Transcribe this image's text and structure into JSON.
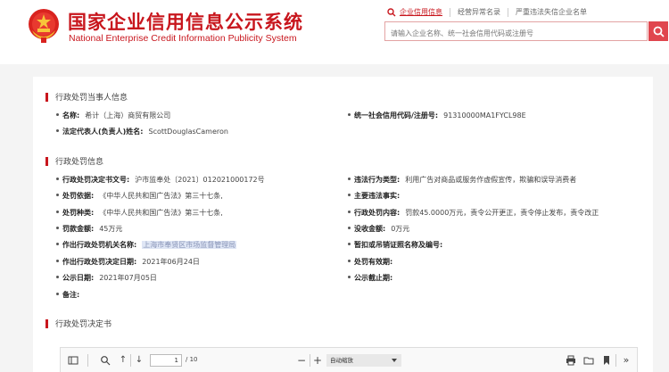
{
  "header": {
    "title_cn": "国家企业信用信息公示系统",
    "title_en": "National Enterprise Credit Information Publicity System",
    "nav": [
      {
        "label": "企业信用信息"
      },
      {
        "label": "经营异常名录"
      },
      {
        "label": "严重违法失信企业名单"
      }
    ],
    "search_placeholder": "请输入企业名称、统一社会信用代码或注册号"
  },
  "party_section": {
    "title": "行政处罚当事人信息",
    "name_label": "名称:",
    "name_value": "希计（上海）商贸有限公司",
    "credit_code_label": "统一社会信用代码/注册号:",
    "credit_code_value": "91310000MA1FYCL98E",
    "legal_rep_label": "法定代表人(负责人)姓名:",
    "legal_rep_value": "ScottDouglasCameron"
  },
  "penalty_section": {
    "title": "行政处罚信息",
    "left": [
      {
        "label": "行政处罚决定书文号:",
        "value": "沪市监奉处〔2021〕012021000172号"
      },
      {
        "label": "处罚依据:",
        "value": "《中华人民共和国广告法》第三十七条,"
      },
      {
        "label": "处罚种类:",
        "value": "《中华人民共和国广告法》第三十七条,"
      },
      {
        "label": "罚款金额:",
        "value": "45万元"
      },
      {
        "label": "作出行政处罚机关名称:",
        "value": "上海市奉贤区市场监督管理局"
      },
      {
        "label": "作出行政处罚决定日期:",
        "value": "2021年06月24日"
      },
      {
        "label": "公示日期:",
        "value": "2021年07月05日"
      },
      {
        "label": "备注:",
        "value": ""
      }
    ],
    "right": [
      {
        "label": "违法行为类型:",
        "value": "利用广告对商品或服务作虚假宣传，欺骗和误导消费者"
      },
      {
        "label": "主要违法事实:",
        "value": ""
      },
      {
        "label": "行政处罚内容:",
        "value": "罚款45.0000万元，责令公开更正，责令停止发布，责令改正"
      },
      {
        "label": "没收金额:",
        "value": "0万元"
      },
      {
        "label": "暂扣或吊销证照名称及编号:",
        "value": ""
      },
      {
        "label": "处罚有效期:",
        "value": ""
      },
      {
        "label": "公示截止期:",
        "value": ""
      }
    ]
  },
  "decision_section": {
    "title": "行政处罚决定书"
  },
  "viewer": {
    "page_current": "1",
    "page_total": "/ 10",
    "zoom": "自动缩放"
  },
  "colors": {
    "brand": "#c8161d",
    "search_button": "#e0464e"
  }
}
